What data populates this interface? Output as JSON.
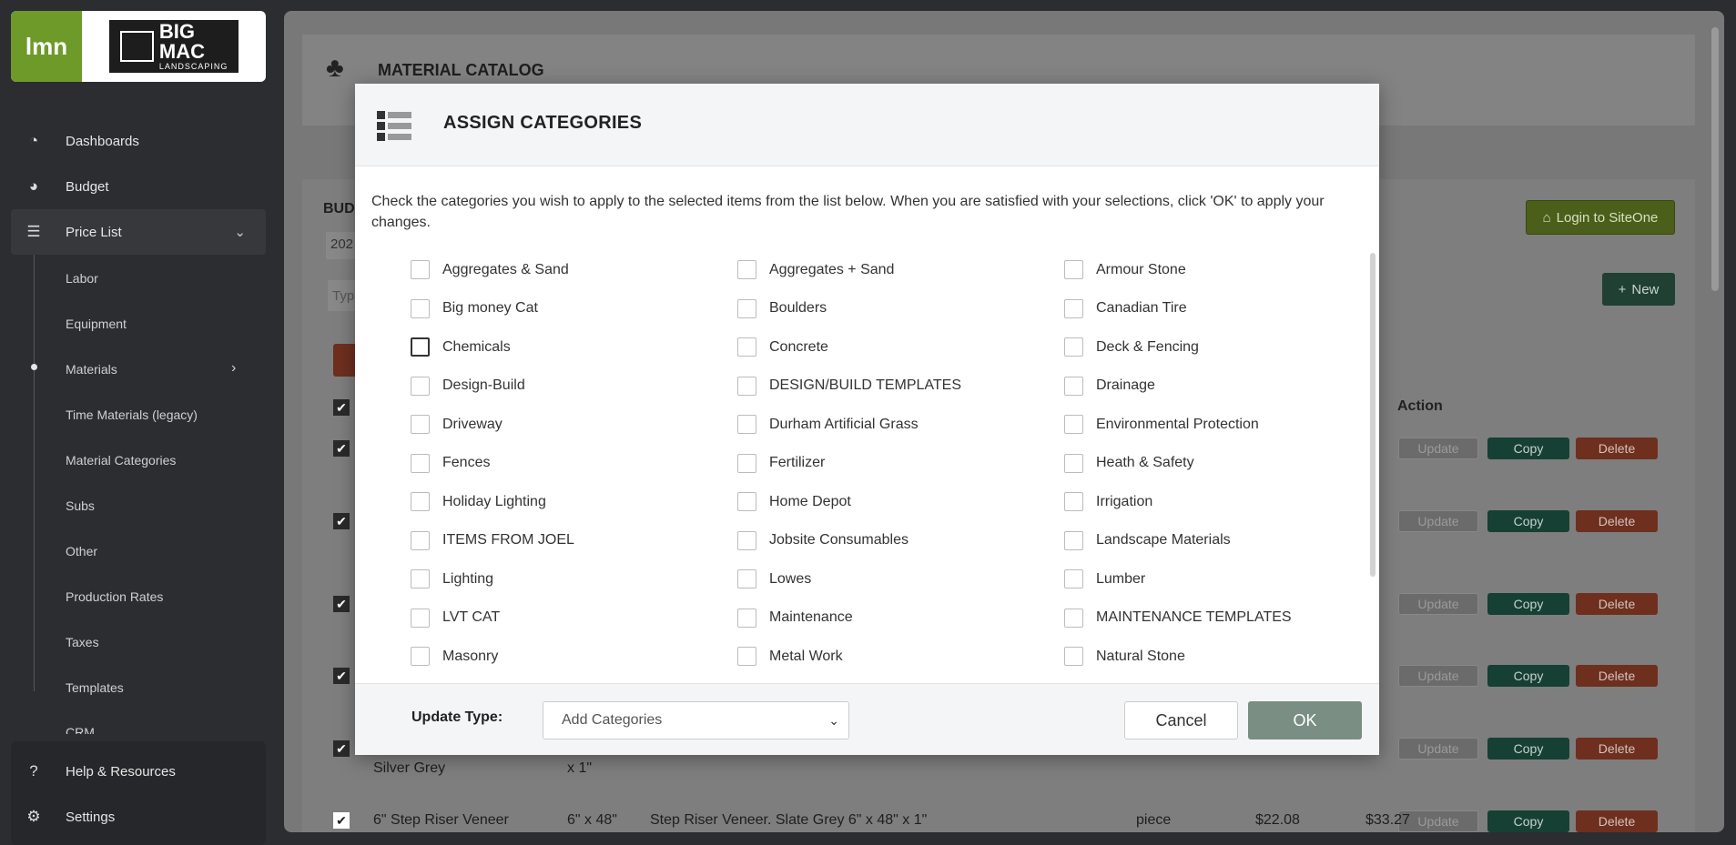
{
  "brand": {
    "lmn": "lmn",
    "company_line1": "BIG",
    "company_line2": "MAC",
    "company_line3": "LANDSCAPING"
  },
  "sidebar": {
    "items": [
      {
        "label": "Dashboards",
        "icon": "gauge-icon"
      },
      {
        "label": "Budget",
        "icon": "pie-chart-icon"
      },
      {
        "label": "Price List",
        "icon": "list-icon"
      }
    ],
    "sub_items": [
      "Labor",
      "Equipment",
      "Materials",
      "Time Materials (legacy)",
      "Material Categories",
      "Subs",
      "Other",
      "Production Rates",
      "Taxes",
      "Templates",
      "CRM"
    ],
    "bottom": [
      {
        "label": "Help & Resources",
        "icon": "help-icon"
      },
      {
        "label": "Settings",
        "icon": "gear-icon"
      }
    ]
  },
  "page": {
    "title": "MATERIAL CATALOG",
    "login_button": "Login to SiteOne",
    "new_button": "New",
    "budget_label": "BUD",
    "budget_value": "202",
    "type_placeholder": "Typ",
    "action_header": "Action",
    "row_buttons": {
      "update": "Update",
      "copy": "Copy",
      "delete": "Delete"
    },
    "row_tail_1": {
      "name": "Silver Grey",
      "size": "x 1\""
    },
    "row_tail_2": {
      "name": "6\" Step Riser Veneer",
      "size": "6\" x 48\"",
      "description": "Step Riser Veneer. Slate Grey 6\" x 48\" x 1\"",
      "unit": "piece",
      "cost": "$22.08",
      "price": "$33.27"
    }
  },
  "modal": {
    "title": "ASSIGN CATEGORIES",
    "description": "Check the categories you wish to apply to the selected items from the list below. When you are satisfied with your selections, click 'OK' to apply your changes.",
    "categories": [
      "Aggregates & Sand",
      "Aggregates + Sand",
      "Armour Stone",
      "Big money Cat",
      "Boulders",
      "Canadian Tire",
      "Chemicals",
      "Concrete",
      "Deck & Fencing",
      "Design-Build",
      "DESIGN/BUILD TEMPLATES",
      "Drainage",
      "Driveway",
      "Durham Artificial Grass",
      "Environmental Protection",
      "Fences",
      "Fertilizer",
      "Heath & Safety",
      "Holiday Lighting",
      "Home Depot",
      "Irrigation",
      "ITEMS FROM JOEL",
      "Jobsite Consumables",
      "Landscape Materials",
      "Lighting",
      "Lowes",
      "Lumber",
      "LVT CAT",
      "Maintenance",
      "MAINTENANCE TEMPLATES",
      "Masonry",
      "Metal Work",
      "Natural Stone"
    ],
    "update_type_label": "Update Type:",
    "update_type_value": "Add Categories",
    "cancel_label": "Cancel",
    "ok_label": "OK"
  }
}
